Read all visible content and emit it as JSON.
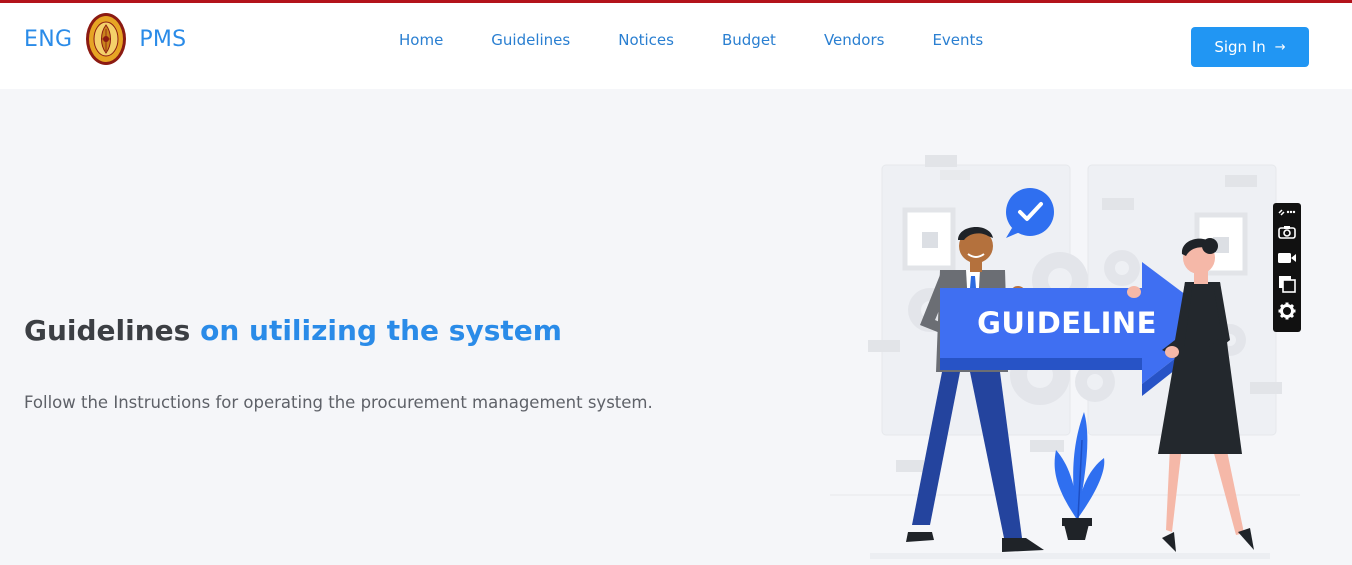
{
  "header": {
    "brand_left": "ENG",
    "brand_right": "PMS",
    "nav": [
      "Home",
      "Guidelines",
      "Notices",
      "Budget",
      "Vendors",
      "Events"
    ],
    "signin_label": "Sign In",
    "signin_arrow": "→"
  },
  "hero": {
    "title_dark": "Guidelines",
    "title_blue": "on utilizing the system",
    "subtitle": "Follow the Instructions for operating the procurement management system."
  },
  "illustration": {
    "banner_text": "GUIDELINE"
  },
  "toolbar": {
    "icons": [
      "link-more-icon",
      "camera-icon",
      "video-icon",
      "copy-icon",
      "gear-icon"
    ]
  },
  "colors": {
    "top_line": "#b3131b",
    "brand": "#2a8be8",
    "nav": "#2a7fd1",
    "button": "#2196f3",
    "banner": "#3f6ff2"
  }
}
